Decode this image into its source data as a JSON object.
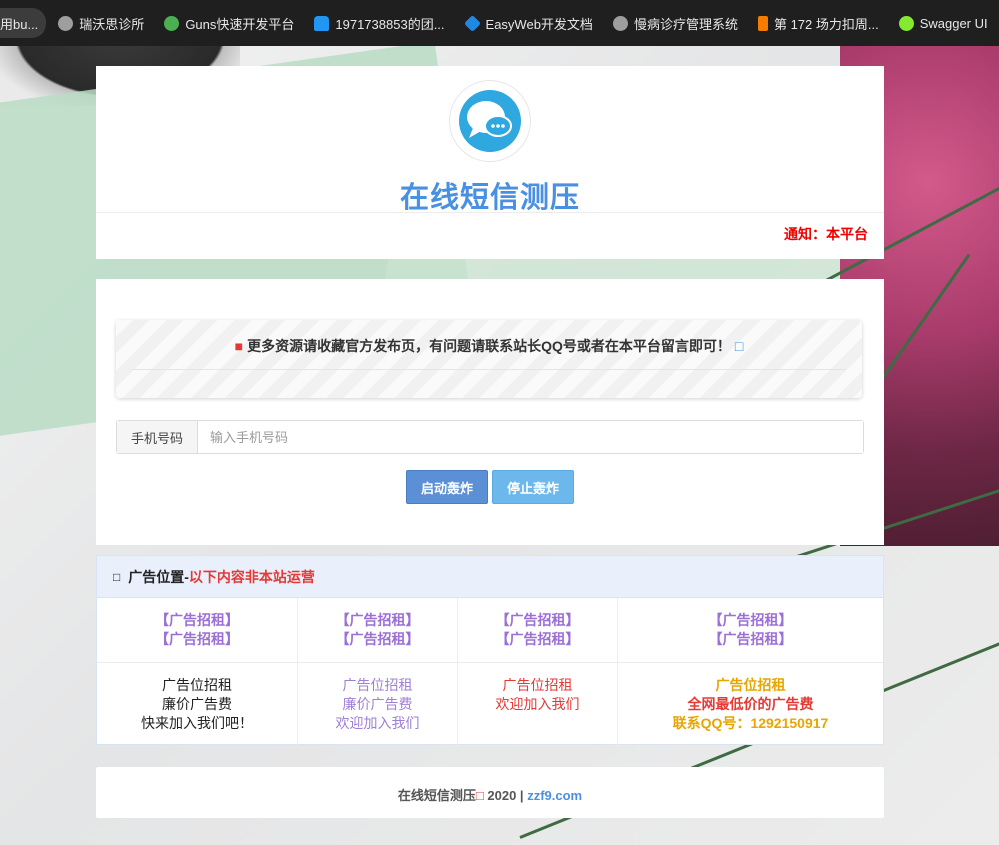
{
  "bookmarks": [
    {
      "label": "用bu...",
      "icon": "partial-icon",
      "color": "#ffffff"
    },
    {
      "label": "瑞沃思诊所",
      "icon": "globe-icon",
      "color": "#9e9e9e"
    },
    {
      "label": "Guns快速开发平台",
      "icon": "guns-logo-icon",
      "color": "#4caf50"
    },
    {
      "label": "1971738853的团...",
      "icon": "ghost-icon",
      "color": "#2196f3"
    },
    {
      "label": "EasyWeb开发文档",
      "icon": "easyweb-logo-icon",
      "color": "#1e88e5"
    },
    {
      "label": "慢病诊疗管理系统",
      "icon": "globe-icon",
      "color": "#9e9e9e"
    },
    {
      "label": "第 172 场力扣周...",
      "icon": "leetcode-icon",
      "color": "#f57c00"
    },
    {
      "label": "Swagger UI",
      "icon": "swagger-icon",
      "color": "#85ea2d"
    }
  ],
  "header": {
    "title": "在线短信测压",
    "notice": "通知：本平台"
  },
  "tip": {
    "text": "更多资源请收藏官方发布页，有问题请联系站长QQ号或者在本平台留言即可！"
  },
  "form": {
    "phone_label": "手机号码",
    "phone_placeholder": "输入手机号码",
    "phone_value": "",
    "start_label": "启动轰炸",
    "stop_label": "停止轰炸"
  },
  "ads": {
    "heading": "广告位置-",
    "heading_red": "以下内容非本站运营",
    "row1": [
      {
        "lines": [
          "【广告招租】",
          "【广告招租】"
        ]
      },
      {
        "lines": [
          "【广告招租】",
          "【广告招租】"
        ]
      },
      {
        "lines": [
          "【广告招租】",
          "【广告招租】"
        ]
      },
      {
        "lines": [
          "【广告招租】",
          "【广告招租】"
        ]
      }
    ],
    "row2": [
      {
        "lines": [
          "广告位招租",
          "廉价广告费",
          "快来加入我们吧！"
        ]
      },
      {
        "lines": [
          "广告位招租",
          "廉价广告费",
          "欢迎加入我们"
        ]
      },
      {
        "lines": [
          "广告位招租",
          "欢迎加入我们"
        ]
      },
      {
        "lines": [
          "广告位招租",
          "全网最低价的广告费",
          "联系QQ号：1292150917"
        ]
      }
    ]
  },
  "footer": {
    "text": "在线短信测压",
    "year": " 2020 | ",
    "link": "zzf9.com"
  }
}
